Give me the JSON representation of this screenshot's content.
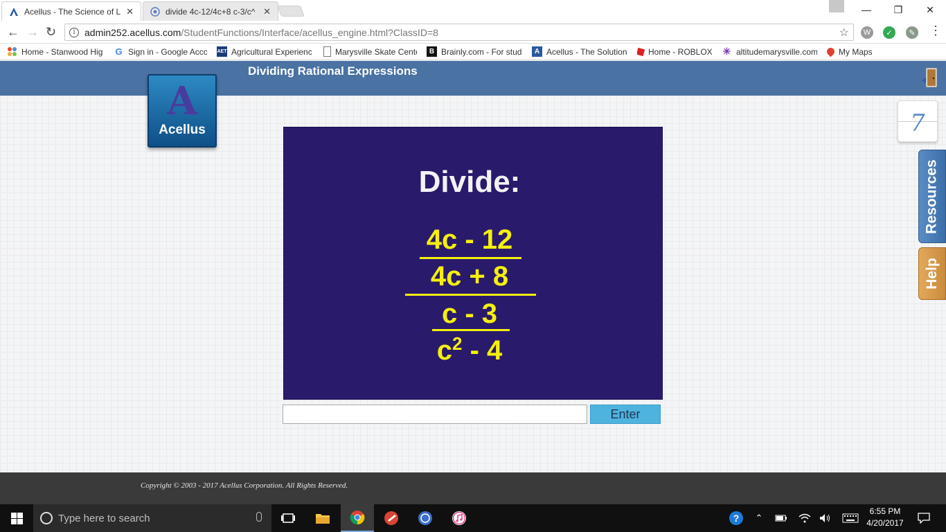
{
  "browser": {
    "tabs": [
      {
        "title": "Acellus - The Science of L",
        "active": true,
        "favicon": "acellus-favicon-icon"
      },
      {
        "title": "divide 4c-12/4c+8 c-3/c^",
        "active": false,
        "favicon": "globe-icon"
      }
    ],
    "url_host": "admin252.acellus.com",
    "url_path": "/StudentFunctions/Interface/acellus_engine.html?ClassID=8",
    "bookmarks": [
      {
        "label": "Home - Stanwood Hig",
        "icon": "joomla-icon",
        "color": "#e5452b"
      },
      {
        "label": "Sign in - Google Acco",
        "icon": "google-icon",
        "color": "#4285f4"
      },
      {
        "label": "Agricultural Experienc",
        "icon": "aet-icon",
        "color": "#1b3c7a"
      },
      {
        "label": "Marysville Skate Cente",
        "icon": "page-icon",
        "color": "#ffffff"
      },
      {
        "label": "Brainly.com - For stud",
        "icon": "brainly-icon",
        "color": "#111111"
      },
      {
        "label": "Acellus - The Solution",
        "icon": "acellus-icon",
        "color": "#2a5aa0"
      },
      {
        "label": "Home - ROBLOX",
        "icon": "roblox-icon",
        "color": "#e02020"
      },
      {
        "label": "altitudemarysville.com",
        "icon": "altitude-icon",
        "color": "#7a3ab0"
      },
      {
        "label": "My Maps",
        "icon": "maps-pin-icon",
        "color": "#e04030"
      }
    ]
  },
  "lesson": {
    "title": "Dividing Rational Expressions",
    "logo_letter": "A",
    "logo_text": "Acellus",
    "problem_heading": "Divide:",
    "top_numerator": "4c - 12",
    "top_denominator": "4c + 8",
    "bottom_numerator": "c - 3",
    "bottom_denominator_base": "c",
    "bottom_denominator_exp": "2",
    "bottom_denominator_rest": " - 4",
    "answer_value": "",
    "enter_label": "Enter",
    "counter": "7",
    "resources_label": "Resources",
    "help_label": "Help"
  },
  "footer": {
    "copyright": "Copyright © 2003 - 2017 Acellus Corporation.  All Rights Reserved."
  },
  "taskbar": {
    "search_placeholder": "Type here to search",
    "time": "6:55 PM",
    "date": "4/20/2017"
  },
  "colors": {
    "header_blue": "#4a72a3",
    "problem_bg": "#2a1a6c",
    "problem_text": "#f4f00c",
    "enter_button": "#4fb3df",
    "resources_tab": "#4a7db8",
    "help_tab": "#d89a4a"
  }
}
